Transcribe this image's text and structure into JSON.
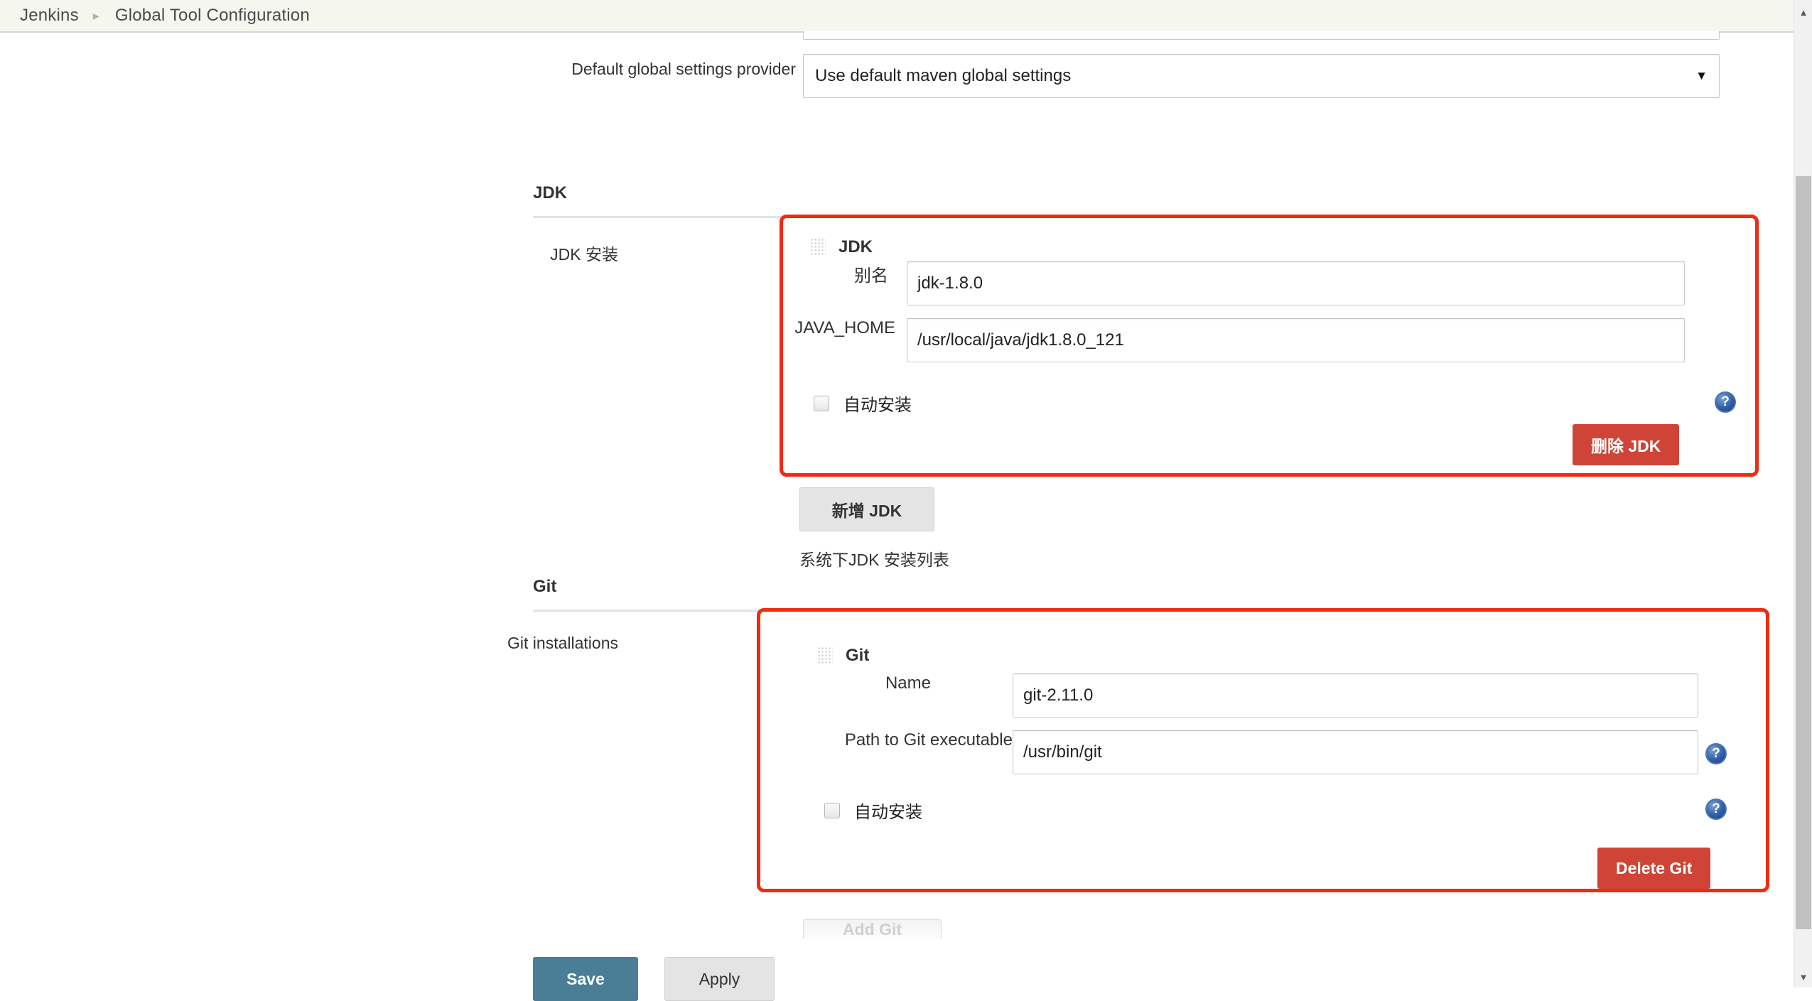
{
  "breadcrumb": {
    "root": "Jenkins",
    "separator": "▸",
    "current": "Global Tool Configuration"
  },
  "maven": {
    "settings_provider_label": "Default global settings provider",
    "settings_provider_value": "Use default maven global settings",
    "dropdown_arrow": "▼"
  },
  "jdk_section": {
    "heading": "JDK",
    "row_label": "JDK 安装",
    "entry_title": "JDK",
    "alias_label": "别名",
    "alias_value": "jdk-1.8.0",
    "java_home_label": "JAVA_HOME",
    "java_home_value": "/usr/local/java/jdk1.8.0_121",
    "auto_install_label": "自动安装",
    "auto_install_checked": false,
    "delete_button": "删除 JDK",
    "add_button": "新增 JDK",
    "hint": "系统下JDK 安装列表",
    "help_icon": "?"
  },
  "git_section": {
    "heading": "Git",
    "row_label": "Git installations",
    "entry_title": "Git",
    "name_label": "Name",
    "name_value": "git-2.11.0",
    "path_label": "Path to Git executable",
    "path_value": "/usr/bin/git",
    "auto_install_label": "自动安装",
    "auto_install_checked": false,
    "delete_button": "Delete Git",
    "add_button": "Add Git",
    "help_icon": "?"
  },
  "footer": {
    "save_label": "Save",
    "apply_label": "Apply"
  },
  "scrollbar": {
    "up_arrow": "▲",
    "down_arrow": "▼"
  },
  "colors": {
    "highlight": "#f02b10",
    "danger": "#cf4436",
    "primary": "#4a7d96",
    "breadcrumb_bg": "#f5f7ef"
  }
}
